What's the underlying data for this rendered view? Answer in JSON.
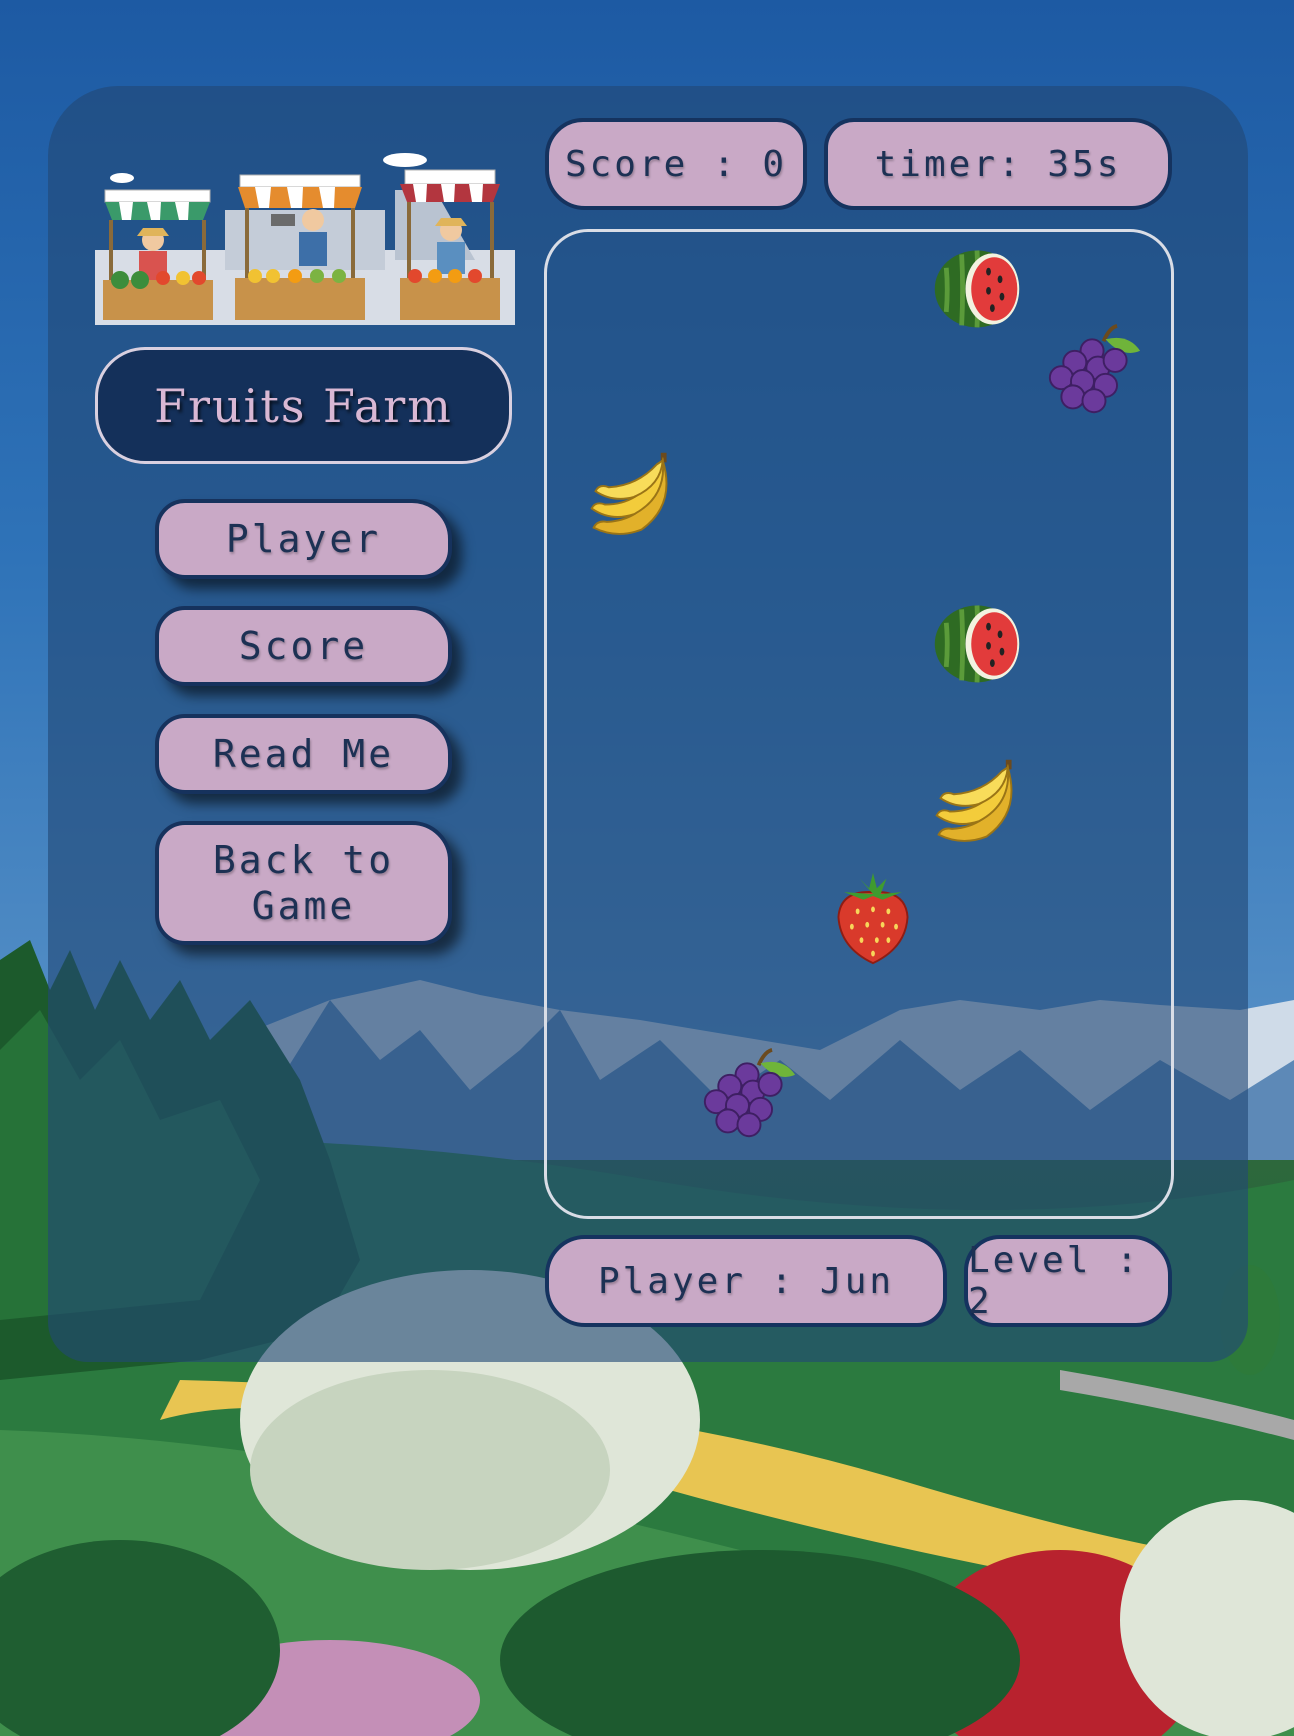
{
  "game": {
    "title": "Fruits Farm",
    "score_label": "Score : 0",
    "timer_label": "timer: 35s",
    "player_label": "Player : Jun",
    "level_label": "Level : 2"
  },
  "menu": {
    "player": "Player",
    "score": "Score",
    "read_me": "Read Me",
    "back_line1": "Back to",
    "back_line2": "Game"
  },
  "fruits": [
    "watermelon",
    "grapes",
    "banana",
    "watermelon",
    "banana",
    "strawberry",
    "grapes"
  ],
  "colors": {
    "panel": "#224876",
    "button": "#c9a9c6",
    "button_border": "#15335f",
    "title_bg": "#14305a",
    "title_text": "#d9b8d4"
  }
}
